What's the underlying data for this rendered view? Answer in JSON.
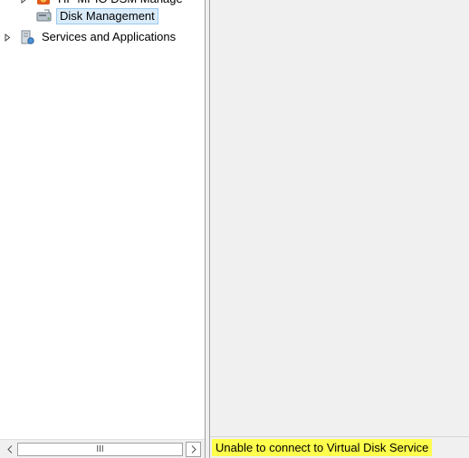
{
  "tree": {
    "items": [
      {
        "label": "HP MPIO DSM Manage",
        "icon": "mpio-dsm-icon",
        "expander": "collapsed"
      },
      {
        "label": "Disk Management",
        "icon": "disk-management-icon",
        "selected": true
      },
      {
        "label": "Services and Applications",
        "icon": "services-applications-icon",
        "expander": "collapsed"
      }
    ]
  },
  "scrollbar": {
    "thumb_grip": "III"
  },
  "status_bar": {
    "message": "Unable to connect to Virtual Disk Service"
  },
  "colors": {
    "status_highlight": "#ffff4d",
    "selection_fill": "#d9ebf9",
    "selection_border": "#99c9ef",
    "pane_background": "#f0f0f0"
  }
}
